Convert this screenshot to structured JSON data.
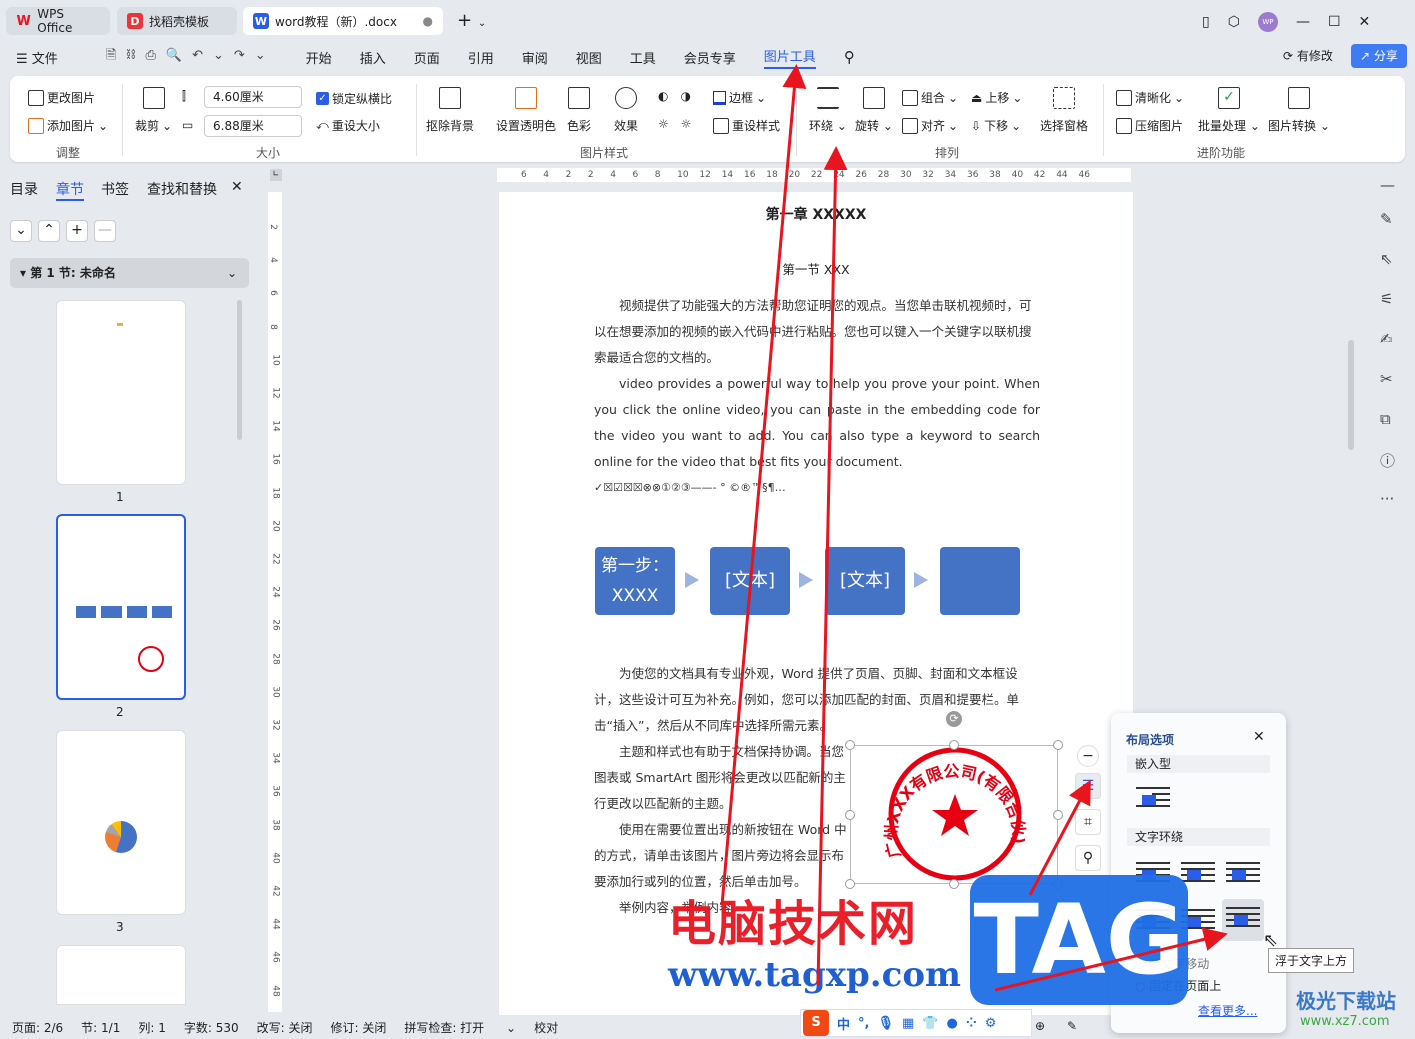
{
  "tabs": [
    {
      "label": "WPS Office"
    },
    {
      "label": "找稻壳模板"
    },
    {
      "label": "word教程（新）.docx"
    }
  ],
  "menu": {
    "file": "文件",
    "items": [
      "开始",
      "插入",
      "页面",
      "引用",
      "审阅",
      "视图",
      "工具",
      "会员专享",
      "图片工具"
    ],
    "modified": "有修改",
    "share": "分享"
  },
  "ribbon": {
    "adjust": {
      "change": "更改图片",
      "add": "添加图片",
      "group": "调整"
    },
    "size": {
      "crop": "裁剪",
      "height": "4.60厘米",
      "width": "6.88厘米",
      "lock": "锁定纵横比",
      "reset": "重设大小",
      "group": "大小"
    },
    "style": {
      "remove_bg": "抠除背景",
      "transparent": "设置透明色",
      "color": "色彩",
      "effect": "效果",
      "border": "边框",
      "reset_style": "重设样式",
      "group": "图片样式"
    },
    "arrange": {
      "wrap": "环绕",
      "rotate": "旋转",
      "combine": "组合",
      "align": "对齐",
      "up": "上移",
      "down": "下移",
      "pane": "选择窗格",
      "group": "排列"
    },
    "advanced": {
      "clarify": "清晰化",
      "compress": "压缩图片",
      "batch": "批量处理",
      "convert": "图片转换",
      "group": "进阶功能"
    }
  },
  "left": {
    "tabs": [
      "目录",
      "章节",
      "书签",
      "查找和替换"
    ],
    "section": "第 1 节: 未命名",
    "pages": [
      "1",
      "2",
      "3"
    ]
  },
  "ruler": {
    "h": [
      "6",
      "4",
      "2",
      "2",
      "4",
      "6",
      "8",
      "10",
      "12",
      "14",
      "16",
      "18",
      "20",
      "22",
      "24",
      "26",
      "28",
      "30",
      "32",
      "34",
      "36",
      "38",
      "40",
      "42",
      "44",
      "46"
    ],
    "v": [
      "2",
      "4",
      "6",
      "8",
      "10",
      "12",
      "14",
      "16",
      "18",
      "20",
      "22",
      "24",
      "26",
      "28",
      "30",
      "32",
      "34",
      "36",
      "38",
      "40",
      "42",
      "44",
      "46",
      "48"
    ]
  },
  "doc": {
    "title": "第一章  XXXXX",
    "subtitle": "第一节  XXX",
    "p1": "视频提供了功能强大的方法帮助您证明您的观点。当您单击联机视频时，可以在想要添加的视频的嵌入代码中进行粘贴。您也可以键入一个关键字以联机搜索最适合您的文档的。",
    "p2": "video provides a powerful way to help you prove your point. When you click the online video, you can paste in the embedding code for the video you want to add. You can also type a keyword to search online for the video that best fits your document.",
    "symbols": "✓☒☑☒☒⊗⊗①②③——-    °  ©®™§¶…",
    "steps": [
      "第一步：XXXX",
      "[文本]",
      "[文本]",
      ""
    ],
    "p3": "为使您的文档具有专业外观，Word 提供了页眉、页脚、封面和文本框设计，这些设计可互为补充。例如，您可以添加匹配的封面、页眉和提要栏。单击“插入”，然后从不同库中选择所需元素。",
    "p4": "主题和样式也有助于文档保持协调。当您",
    "p4b": "图表或 SmartArt 图形将会更改以匹配新的主",
    "p4c": "行更改以匹配新的主题。",
    "p5": "使用在需要位置出现的新按钮在 Word 中",
    "p5b": "的方式，请单击该图片，图片旁边将会显示布",
    "p5c": "要添加行或列的位置，然后单击加号。",
    "p6": "举例内容，举例内容。",
    "seal_text": "广州XXX有限公司(有限合伙)"
  },
  "popup": {
    "title": "布局选项",
    "inline": "嵌入型",
    "wrap": "文字环绕",
    "move": "随文字移动",
    "fix": "固定在页面上",
    "more": "查看更多...",
    "tooltip": "浮于文字上方"
  },
  "status": {
    "page": "页面: 2/6",
    "section": "节: 1/1",
    "col": "列: 1",
    "words": "字数: 530",
    "overtype": "改写: 关闭",
    "revise": "修订: 关闭",
    "spell": "拼写检查: 打开",
    "proof": "校对"
  },
  "ime": "中",
  "watermarks": {
    "cn": "电脑技术网",
    "url": "www.tagxp.com",
    "tag": "TAG",
    "xz": "极光下载站",
    "xzurl": "www.xz7.com"
  },
  "colors": {
    "accent": "#2b5ee8",
    "shape": "#4472c4",
    "seal": "#e60012",
    "arrow": "#e8141e"
  }
}
